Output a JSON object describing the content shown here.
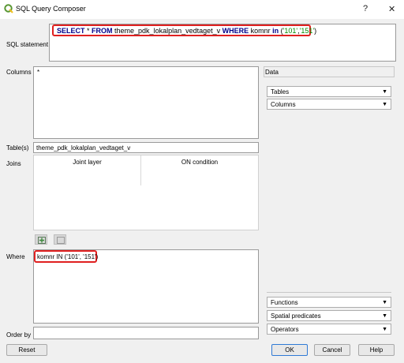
{
  "window": {
    "title": "SQL Query Composer",
    "help_glyph": "?",
    "close_glyph": "✕"
  },
  "sql": {
    "label": "SQL statement",
    "parts": [
      "SELECT",
      " * ",
      "FROM",
      " theme_pdk_lokalplan_vedtaget_v ",
      "WHERE",
      " komnr ",
      "in",
      " (",
      "'101'",
      ",",
      "'151'",
      ")"
    ]
  },
  "columns": {
    "label": "Columns",
    "value": "*"
  },
  "tables": {
    "label": "Table(s)",
    "value": "theme_pdk_lokalplan_vedtaget_v"
  },
  "joins": {
    "label": "Joins",
    "headers": [
      "Joint layer",
      "ON condition"
    ]
  },
  "where": {
    "label": "Where",
    "value": "komnr IN ('101', '151')"
  },
  "order_by": {
    "label": "Order by",
    "value": ""
  },
  "right_panel": {
    "data_label": "Data",
    "combos": [
      "Tables",
      "Columns"
    ],
    "bottom_combos": [
      "Functions",
      "Spatial predicates",
      "Operators"
    ]
  },
  "buttons": {
    "reset": "Reset",
    "ok": "OK",
    "cancel": "Cancel",
    "help": "Help"
  },
  "colors": {
    "accent": "#2f7ad6",
    "highlight": "#e02020",
    "keyword": "#00008b",
    "string": "#008a00"
  }
}
